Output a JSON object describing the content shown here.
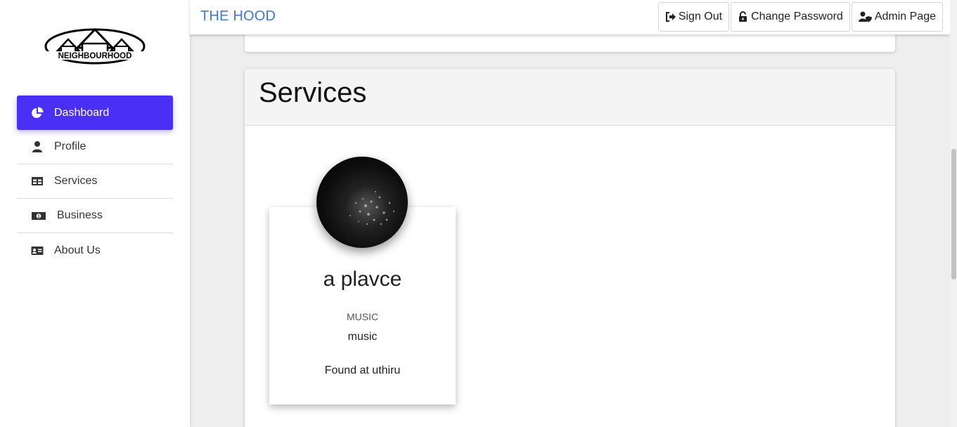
{
  "brand": {
    "logo_text": "NEIGHBOURHOOD",
    "title": "THE HOOD"
  },
  "sidebar": {
    "items": [
      {
        "label": "Dashboard",
        "icon": "pie-chart-icon",
        "active": true
      },
      {
        "label": "Profile",
        "icon": "user-icon",
        "active": false
      },
      {
        "label": "Services",
        "icon": "table-icon",
        "active": false
      },
      {
        "label": "Business",
        "icon": "money-bill-icon",
        "active": false
      },
      {
        "label": "About Us",
        "icon": "id-card-icon",
        "active": false
      }
    ]
  },
  "topbar": {
    "sign_out": "Sign Out",
    "change_password": "Change Password",
    "admin_page": "Admin Page"
  },
  "main": {
    "section_title": "Services",
    "services": [
      {
        "name": "a plavce",
        "category": "MUSIC",
        "description": "music",
        "location": "Found at uthiru"
      }
    ]
  },
  "colors": {
    "accent": "#4a2ff5",
    "brand": "#3a7bd5"
  }
}
